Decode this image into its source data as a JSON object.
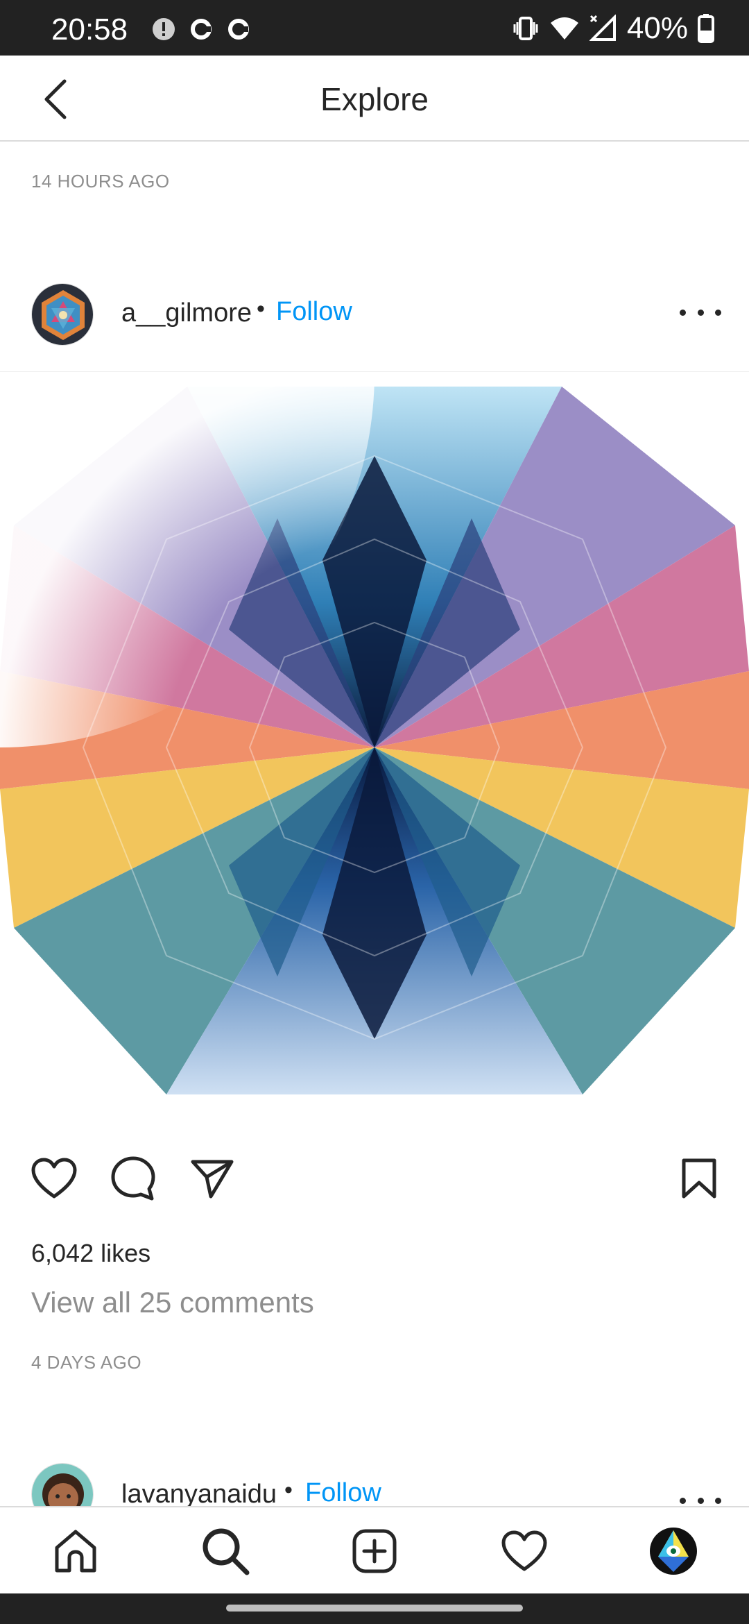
{
  "status_bar": {
    "time": "20:58",
    "battery": "40%",
    "icons": [
      "alert-icon",
      "sync-icon",
      "sync-icon",
      "vibrate-icon",
      "wifi-icon",
      "signal-icon",
      "battery-icon"
    ]
  },
  "header": {
    "title": "Explore",
    "back_icon": "chevron-left-icon"
  },
  "feed": {
    "prev_post_time": "14 HOURS AGO",
    "posts": [
      {
        "username": "a__gilmore",
        "separator": "•",
        "follow_label": "Follow",
        "likes": "6,042 likes",
        "comments_link": "View all 25 comments",
        "time": "4 DAYS AGO"
      },
      {
        "username": "lavanyanaidu",
        "separator": "•",
        "follow_label": "Follow"
      }
    ]
  },
  "bottom_nav": {
    "items": [
      "home-icon",
      "search-icon",
      "add-post-icon",
      "activity-heart-icon",
      "profile-avatar"
    ]
  },
  "colors": {
    "accent": "#0095f6",
    "text": "#262626",
    "muted": "#8e8e8e",
    "status_bar": "#222222"
  }
}
